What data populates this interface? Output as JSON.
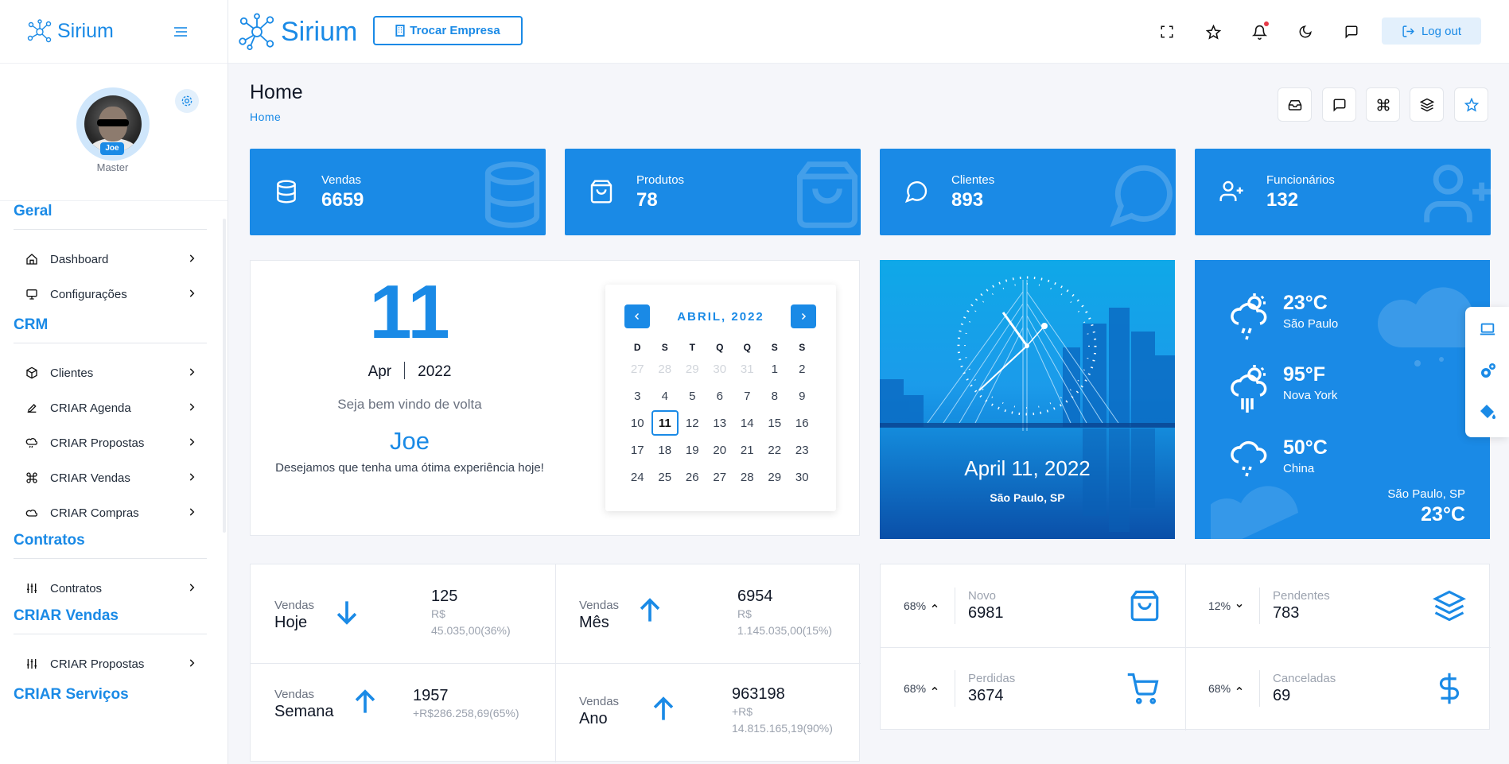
{
  "brand": {
    "name": "Sirium"
  },
  "topbar": {
    "switch_company_label": "Trocar Empresa",
    "logout_label": "Log out"
  },
  "profile": {
    "badge": "Joe",
    "role": "Master"
  },
  "sidebar": {
    "sections": [
      {
        "title": "Geral",
        "items": [
          {
            "label": "Dashboard",
            "icon": "home-icon"
          },
          {
            "label": "Configurações",
            "icon": "monitor-icon"
          }
        ]
      },
      {
        "title": "CRM",
        "items": [
          {
            "label": "Clientes",
            "icon": "box-icon"
          },
          {
            "label": "CRIAR Agenda",
            "icon": "pen-icon"
          },
          {
            "label": "CRIAR Propostas",
            "icon": "cloud-rain-icon"
          },
          {
            "label": "CRIAR Vendas",
            "icon": "command-icon"
          },
          {
            "label": "CRIAR Compras",
            "icon": "cloud-icon"
          }
        ]
      },
      {
        "title": "Contratos",
        "items": [
          {
            "label": "Contratos",
            "icon": "sliders-icon"
          }
        ]
      },
      {
        "title": "CRIAR Vendas",
        "items": [
          {
            "label": "CRIAR Propostas",
            "icon": "sliders-icon"
          }
        ]
      },
      {
        "title": "CRIAR Serviços",
        "items": []
      }
    ]
  },
  "page": {
    "title": "Home",
    "breadcrumb": "Home"
  },
  "stats": [
    {
      "label": "Vendas",
      "value": "6659",
      "icon": "database-icon"
    },
    {
      "label": "Produtos",
      "value": "78",
      "icon": "shopping-bag-icon"
    },
    {
      "label": "Clientes",
      "value": "893",
      "icon": "message-circle-icon"
    },
    {
      "label": "Funcionários",
      "value": "132",
      "icon": "user-plus-icon"
    }
  ],
  "date_card": {
    "day": "11",
    "month": "Apr",
    "year": "2022",
    "welcome": "Seja bem vindo de volta",
    "user": "Joe",
    "message": "Desejamos que tenha uma ótima experiência hoje!"
  },
  "calendar": {
    "title": "ABRIL, 2022",
    "weekdays": [
      "D",
      "S",
      "T",
      "Q",
      "Q",
      "S",
      "S"
    ],
    "days": [
      {
        "d": "27",
        "muted": true
      },
      {
        "d": "28",
        "muted": true
      },
      {
        "d": "29",
        "muted": true
      },
      {
        "d": "30",
        "muted": true
      },
      {
        "d": "31",
        "muted": true
      },
      {
        "d": "1"
      },
      {
        "d": "2"
      },
      {
        "d": "3"
      },
      {
        "d": "4"
      },
      {
        "d": "5"
      },
      {
        "d": "6"
      },
      {
        "d": "7"
      },
      {
        "d": "8"
      },
      {
        "d": "9"
      },
      {
        "d": "10"
      },
      {
        "d": "11",
        "today": true
      },
      {
        "d": "12"
      },
      {
        "d": "13"
      },
      {
        "d": "14"
      },
      {
        "d": "15"
      },
      {
        "d": "16"
      },
      {
        "d": "17"
      },
      {
        "d": "18"
      },
      {
        "d": "19"
      },
      {
        "d": "20"
      },
      {
        "d": "21"
      },
      {
        "d": "22"
      },
      {
        "d": "23"
      },
      {
        "d": "24"
      },
      {
        "d": "25"
      },
      {
        "d": "26"
      },
      {
        "d": "27"
      },
      {
        "d": "28"
      },
      {
        "d": "29"
      },
      {
        "d": "30"
      }
    ]
  },
  "clock_card": {
    "date": "April 11, 2022",
    "location": "São Paulo, SP"
  },
  "weather": {
    "rows": [
      {
        "temp": "23°C",
        "city": "São Paulo"
      },
      {
        "temp": "95°F",
        "city": "Nova York"
      },
      {
        "temp": "50°C",
        "city": "China"
      }
    ],
    "footer_city": "São Paulo, SP",
    "footer_temp": "23°C"
  },
  "sales": [
    {
      "label": "Vendas",
      "period": "Hoje",
      "trend": "down",
      "count": "125",
      "sub1": "R$",
      "sub2": "45.035,00(36%)"
    },
    {
      "label": "Vendas",
      "period": "Mês",
      "trend": "up",
      "count": "6954",
      "sub1": "R$",
      "sub2": "1.145.035,00(15%)"
    },
    {
      "label": "Vendas",
      "period": "Semana",
      "trend": "up",
      "count": "1957",
      "sub1": "+R$286.258,69(65%)",
      "sub2": ""
    },
    {
      "label": "Vendas",
      "period": "Ano",
      "trend": "up",
      "count": "963198",
      "sub1": "+R$",
      "sub2": "14.815.165,19(90%)"
    }
  ],
  "orders": [
    {
      "pct": "68%",
      "caret": "up",
      "label": "Novo",
      "value": "6981",
      "icon": "shopping-bag-icon"
    },
    {
      "pct": "12%",
      "caret": "down",
      "label": "Pendentes",
      "value": "783",
      "icon": "layers-icon"
    },
    {
      "pct": "68%",
      "caret": "up",
      "label": "Perdidas",
      "value": "3674",
      "icon": "shopping-cart-icon"
    },
    {
      "pct": "68%",
      "caret": "up",
      "label": "Canceladas",
      "value": "69",
      "icon": "dollar-icon"
    }
  ],
  "colors": {
    "primary": "#1a8ae6",
    "light_primary": "#e3f0fc",
    "danger": "#e63946"
  }
}
